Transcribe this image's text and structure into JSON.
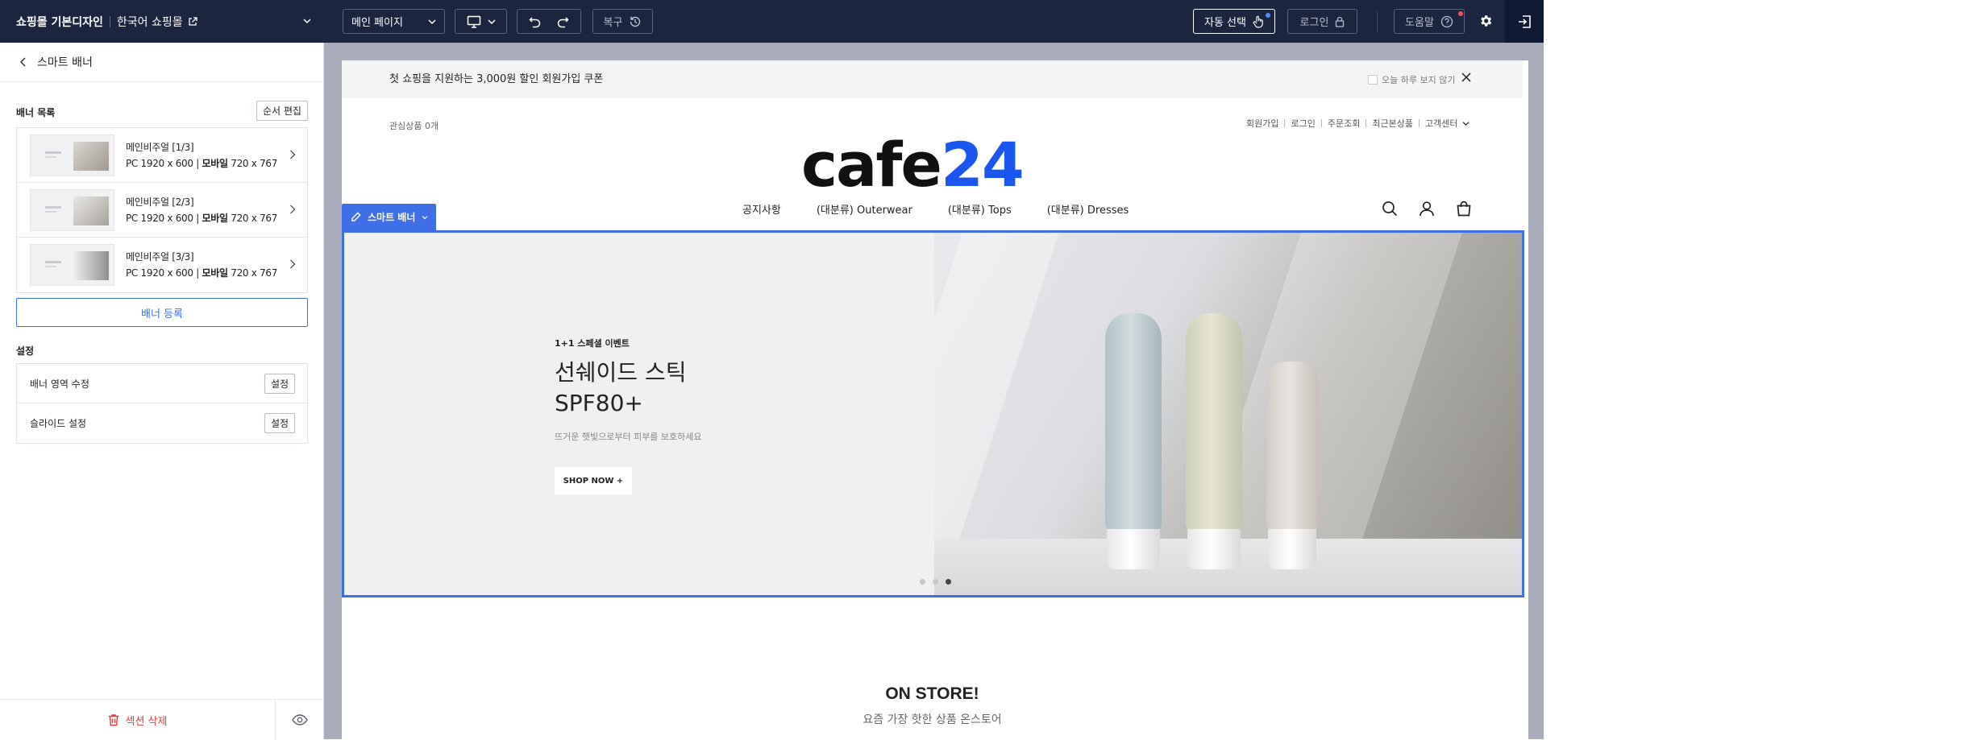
{
  "topbar": {
    "app_name": "쇼핑몰 기본디자인",
    "shop_name": "한국어 쇼핑몰",
    "page_select": "메인 페이지",
    "restore_label": "복구",
    "auto_select_label": "자동 선택",
    "login_label": "로그인",
    "help_label": "도움말"
  },
  "left_panel": {
    "back_title": "스마트 배너",
    "banner_list_label": "배너 목록",
    "order_edit_label": "순서 편집",
    "banners": [
      {
        "name": "메인비주얼 [1/3]",
        "pc": "PC 1920 x 600",
        "mobile_label": "모바일",
        "mobile": "720 x 767"
      },
      {
        "name": "메인비주얼 [2/3]",
        "pc": "PC 1920 x 600",
        "mobile_label": "모바일",
        "mobile": "720 x 767"
      },
      {
        "name": "메인비주얼 [3/3]",
        "pc": "PC 1920 x 600",
        "mobile_label": "모바일",
        "mobile": "720 x 767"
      }
    ],
    "register_label": "배너 등록",
    "settings_label": "설정",
    "settings": [
      {
        "label": "배너 영역 수정",
        "button": "설정"
      },
      {
        "label": "슬라이드 설정",
        "button": "설정"
      }
    ],
    "delete_section_label": "섹션 삭제"
  },
  "preview": {
    "announce_text": "첫 쇼핑을 지원하는 3,000원 할인 회원가입 쿠폰",
    "announce_today": "오늘 하루 보지 않기",
    "wishlist": "관심상품 0개",
    "util_links": [
      "회원가입",
      "로그인",
      "주문조회",
      "최근본상품",
      "고객센터"
    ],
    "logo_text": "cafe24",
    "gnb": [
      "공지사항",
      "(대분류) Outerwear",
      "(대분류) Tops",
      "(대분류) Dresses"
    ],
    "smart_tag": "스마트 배너",
    "hero": {
      "eyebrow": "1+1 스페셜 이벤트",
      "headline_1": "선쉐이드 스틱",
      "headline_2": "SPF80+",
      "sub": "뜨거운 햇빛으로부터 피부를 보호하세요",
      "cta": "SHOP NOW +",
      "active_slide": 3,
      "slide_count": 3
    },
    "section_title": "ON STORE!",
    "section_sub": "요즘 가장 핫한 상품 온스토어"
  },
  "colors": {
    "topbar_bg": "#1b2540",
    "accent": "#3f6fe6",
    "danger": "#e53a3a",
    "logo_blue": "#1a56f0"
  }
}
